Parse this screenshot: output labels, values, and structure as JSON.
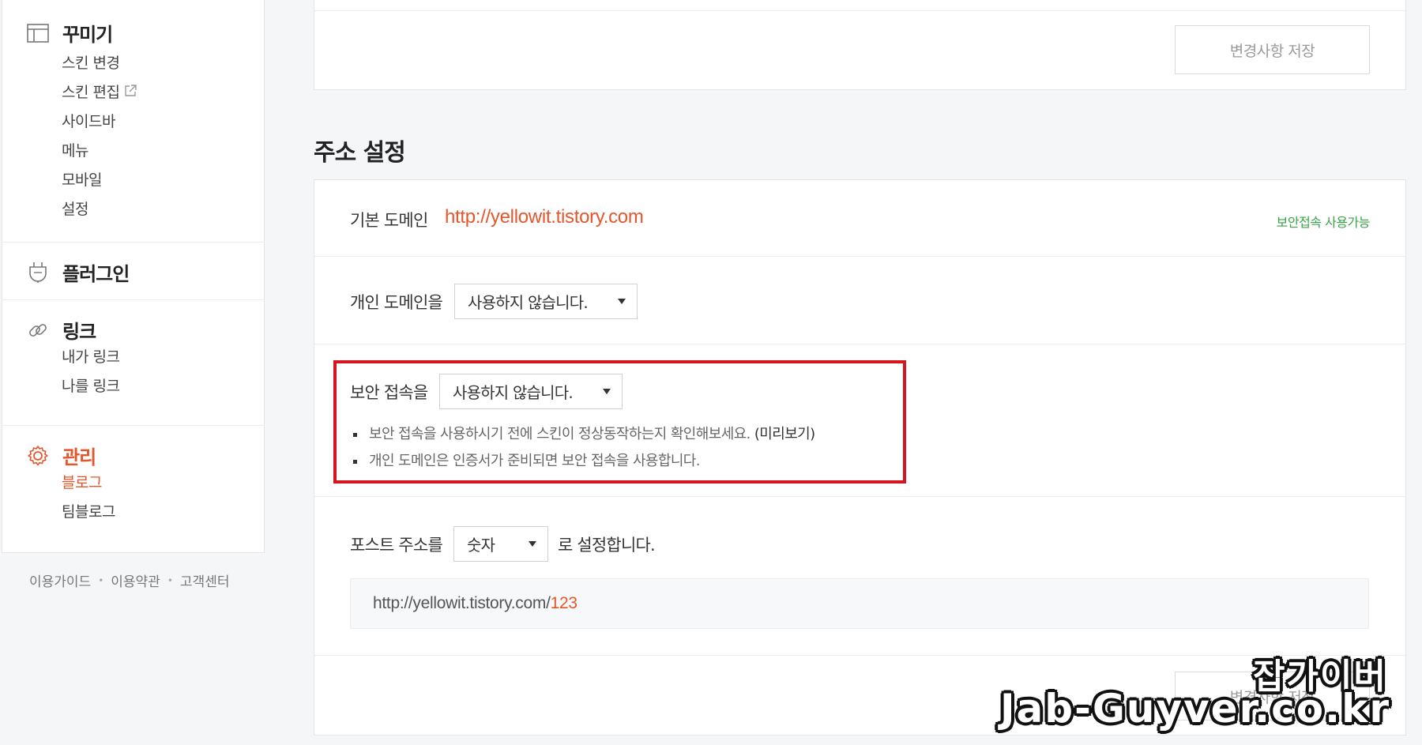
{
  "sidebar": {
    "groups": [
      {
        "title": "꾸미기",
        "icon": "layout-icon",
        "items": [
          "스킨 변경",
          "스킨 편집",
          "사이드바",
          "메뉴",
          "모바일",
          "설정"
        ]
      },
      {
        "title": "플러그인",
        "icon": "plugin-icon",
        "items": []
      },
      {
        "title": "링크",
        "icon": "link-icon",
        "items": [
          "내가 링크",
          "나를 링크"
        ]
      },
      {
        "title": "관리",
        "icon": "gear-icon",
        "items": [
          "블로그",
          "팀블로그"
        ],
        "active_item": "블로그"
      }
    ],
    "external_icon": "external-link-icon",
    "accent_color": "#e5562b"
  },
  "footer": {
    "links": [
      "이용가이드",
      "이용약관",
      "고객센터"
    ]
  },
  "top_card": {
    "save_label": "변경사항 저장"
  },
  "section": {
    "title": "주소 설정",
    "default_domain": {
      "label": "기본 도메인",
      "url": "http://yellowit.tistory.com",
      "secure_badge": "보안접속 사용가능",
      "badge_color": "#3aa348"
    },
    "personal_domain": {
      "label": "개인 도메인을",
      "selected": "사용하지 않습니다."
    },
    "secure_access": {
      "label": "보안 접속을",
      "selected": "사용하지 않습니다.",
      "notes": [
        {
          "text": "보안 접속을 사용하시기 전에 스킨이 정상동작하는지 확인해보세요.",
          "link": "(미리보기)"
        },
        {
          "text": "개인 도메인은 인증서가 준비되면 보안 접속을 사용합니다."
        }
      ],
      "highlight_color": "#d6161c"
    },
    "post_address": {
      "label": "포스트 주소를",
      "selected": "숫자",
      "suffix": "로 설정합니다.",
      "example_base": "http://yellowit.tistory.com/",
      "example_num": "123"
    },
    "save_label": "변경사항 저장"
  },
  "watermark": {
    "korean": "잡가이버",
    "english": "Jab-Guyver.co.kr"
  }
}
